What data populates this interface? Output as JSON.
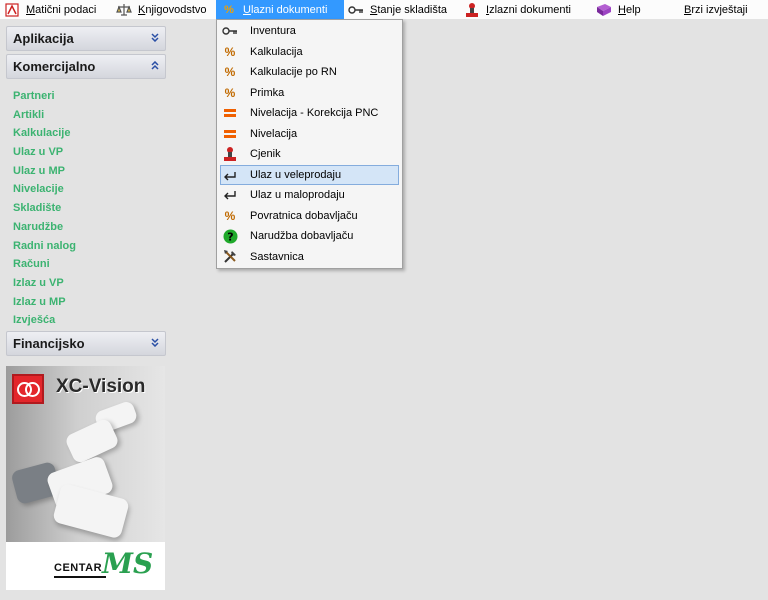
{
  "menubar": {
    "items": [
      {
        "label": "Matični podaci",
        "icon": "matrix-icon"
      },
      {
        "label": "Knjigovodstvo",
        "icon": "scales-icon"
      },
      {
        "label": "Ulazni dokumenti",
        "icon": "percent-icon",
        "active": true
      },
      {
        "label": "Stanje skladišta",
        "icon": "key-icon"
      },
      {
        "label": "Izlazni dokumenti",
        "icon": "stamp-icon"
      },
      {
        "label": "Help",
        "icon": "book-icon"
      },
      {
        "label": "Brzi izvještaji",
        "icon": ""
      }
    ]
  },
  "sidebar": {
    "sections": [
      {
        "title": "Aplikacija",
        "expanded": false
      },
      {
        "title": "Komercijalno",
        "expanded": true
      },
      {
        "title": "Financijsko",
        "expanded": false
      }
    ],
    "links": [
      "Partneri",
      "Artikli",
      "Kalkulacije",
      "Ulaz u VP",
      "Ulaz u MP",
      "Nivelacije",
      "Skladište",
      "Narudžbe",
      "Radni nalog",
      "Računi",
      "Izlaz u VP",
      "Izlaz u MP",
      "Izvješća"
    ],
    "link_color": "#3cb371"
  },
  "logo": {
    "product_name": "XC-Vision",
    "company_prefix": "CENTAR",
    "company_mark": "MS"
  },
  "dropdown": {
    "items": [
      {
        "label": "Inventura",
        "icon": "key-icon"
      },
      {
        "label": "Kalkulacija",
        "icon": "percent-icon"
      },
      {
        "label": "Kalkulacije po RN",
        "icon": "percent-icon"
      },
      {
        "label": "Primka",
        "icon": "percent-icon"
      },
      {
        "label": "Nivelacija - Korekcija PNC",
        "icon": "equals-icon"
      },
      {
        "label": "Nivelacija",
        "icon": "equals-icon"
      },
      {
        "label": "Cjenik",
        "icon": "stamp-icon"
      },
      {
        "label": "Ulaz u veleprodaju",
        "icon": "return-arrow-icon",
        "highlighted": true
      },
      {
        "label": "Ulaz u maloprodaju",
        "icon": "return-arrow-icon"
      },
      {
        "label": "Povratnica dobavljaču",
        "icon": "percent-icon"
      },
      {
        "label": "Narudžba dobavljaču",
        "icon": "question-icon"
      },
      {
        "label": "Sastavnica",
        "icon": "tools-icon"
      }
    ]
  }
}
